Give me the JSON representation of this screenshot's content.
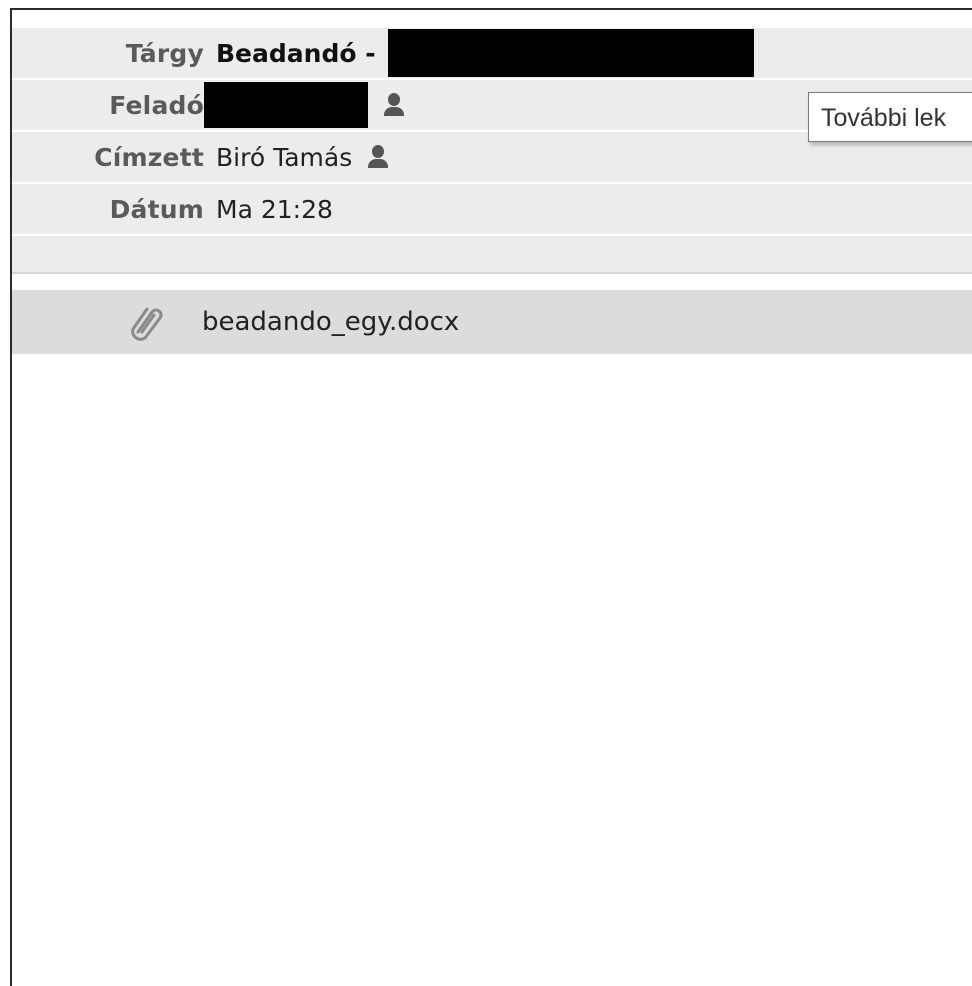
{
  "headers": {
    "subject": {
      "label": "Tárgy",
      "value": "Beadandó -"
    },
    "from": {
      "label": "Feladó"
    },
    "to": {
      "label": "Címzett",
      "value": "Biró Tamás"
    },
    "date": {
      "label": "Dátum",
      "value": "Ma 21:28"
    }
  },
  "tooltip": {
    "text": "További lek"
  },
  "attachment": {
    "filename": "beadando_egy.docx",
    "icon": "paperclip-icon"
  },
  "colors": {
    "header_bg": "#ececec",
    "attachment_bg": "#dcdcdc",
    "label_text": "#5a5a5a",
    "redaction": "#000000"
  }
}
